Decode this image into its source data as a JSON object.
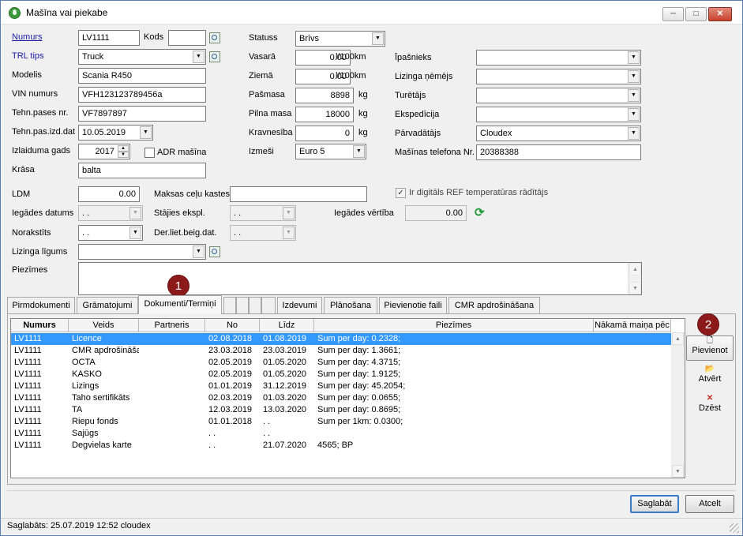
{
  "window": {
    "title": "Mašīna vai piekabe",
    "min": "─",
    "max": "□",
    "close": "✕"
  },
  "labels": {
    "numurs": "Numurs",
    "kods": "Kods",
    "trl_tips": "TRL tips",
    "modelis": "Modelis",
    "vin": "VIN numurs",
    "tehn_pases": "Tehn.pases nr.",
    "tehn_izd": "Tehn.pas.izd.dat",
    "izlaiduma": "Izlaiduma gads",
    "adr": "ADR mašīna",
    "krasa": "Krāsa",
    "statuss": "Statuss",
    "vasara": "Vasarā",
    "ziema": "Ziemā",
    "pasmasa": "Pašmasa",
    "pilna_masa": "Pilna masa",
    "kravnesiba": "Kravnesība",
    "izmesi": "Izmeši",
    "ipasnieks": "Īpašnieks",
    "lizinga_nemejs": "Lizinga ņēmējs",
    "turetajs": "Turētājs",
    "ekspedicija": "Ekspedīcija",
    "parvadatajs": "Pārvadātājs",
    "telefona": "Mašīnas telefona Nr.",
    "unit_l100": "l/100km",
    "unit_kg": "kg",
    "ldm": "LDM",
    "maksas": "Maksas ceļu kastes",
    "ir_digitals": "Ir digitāls REF temperatūras rādītājs",
    "iegades_datums": "Iegādes datums",
    "stajies": "Stājies ekspl.",
    "iegades_vertiba": "Iegādes vērtība",
    "norakstits": "Norakstīts",
    "der_liet": "Der.liet.beig.dat.",
    "lizinga_ligums": "Lizinga līgums",
    "piezimes": "Piezīmes"
  },
  "values": {
    "numurs": "LV1111",
    "kods": "",
    "trl_tips": "Truck",
    "modelis": "Scania R450",
    "vin": "VFH123123789456a",
    "tehn_pases": "VF7897897",
    "tehn_izd": "10.05.2019",
    "izlaiduma": "2017",
    "krasa": "balta",
    "statuss": "Brīvs",
    "vasara": "0.00",
    "ziema": "0.00",
    "pasmasa": "8898",
    "pilna_masa": "18000",
    "kravnesiba": "0",
    "izmesi": "Euro 5",
    "ipasnieks": "",
    "lizinga_nemejs": "",
    "turetajs": "",
    "ekspedicija": "",
    "parvadatajs": "Cloudex",
    "telefona": "20388388",
    "ldm": "0.00",
    "maksas": "",
    "iegades_datums": " .  .",
    "stajies": " .  .",
    "iegades_vertiba": "0.00",
    "norakstits": " .  .",
    "der_liet": " .  .",
    "lizinga_ligums": ""
  },
  "checks": {
    "adr": "",
    "ir_digitals": "✓"
  },
  "tabs": [
    "Pirmdokumenti",
    "Grāmatojumi",
    "Dokumenti/Termiņi",
    "",
    "",
    "",
    "",
    "Izdevumi",
    "Plānošana",
    "Pievienotie faili",
    "CMR apdrošināšana"
  ],
  "grid": {
    "headers": [
      "Numurs",
      "Veids",
      "Partneris",
      "No",
      "Līdz",
      "Piezīmes",
      "Nākamā maiņa pēc"
    ],
    "rows": [
      [
        "LV1111",
        "Licence",
        "",
        "02.08.2018",
        "01.08.2019",
        "Sum per day: 0.2328;",
        ""
      ],
      [
        "LV1111",
        "CMR apdrošināšar",
        "",
        "23.03.2018",
        "23.03.2019",
        "Sum per day: 1.3661;",
        ""
      ],
      [
        "LV1111",
        "OCTA",
        "",
        "02.05.2019",
        "01.05.2020",
        "Sum per day: 4.3715;",
        ""
      ],
      [
        "LV1111",
        "KASKO",
        "",
        "02.05.2019",
        "01.05.2020",
        "Sum per day: 1.9125;",
        ""
      ],
      [
        "LV1111",
        "Lizings",
        "",
        "01.01.2019",
        "31.12.2019",
        "Sum per day: 45.2054;",
        ""
      ],
      [
        "LV1111",
        "Taho sertifikāts",
        "",
        "02.03.2019",
        "01.03.2020",
        "Sum per day: 0.0655;",
        ""
      ],
      [
        "LV1111",
        "TA",
        "",
        "12.03.2019",
        "13.03.2020",
        "Sum per day: 0.8695;",
        ""
      ],
      [
        "LV1111",
        "Riepu fonds",
        "",
        "01.01.2018",
        " .  .",
        "Sum per 1km: 0.0300;",
        ""
      ],
      [
        "LV1111",
        "Sajūgs",
        "",
        " .  .",
        " .  .",
        "",
        ""
      ],
      [
        "LV1111",
        "Degvielas karte",
        "",
        " .  .",
        "21.07.2020",
        "4565; BP",
        ""
      ]
    ]
  },
  "side": {
    "pievienot": "Pievienot",
    "atvert": "Atvērt",
    "dzest": "Dzēst"
  },
  "buttons": {
    "saglabat": "Saglabāt",
    "atcelt": "Atcelt"
  },
  "status": "Saglabāts: 25.07.2019 12:52 cloudex",
  "badges": [
    "1",
    "2"
  ],
  "icons": {
    "dropdown": "▼",
    "scroll_up": "▲",
    "scroll_down": "▼",
    "spin_up": "▲",
    "spin_down": "▼",
    "refresh": "⟳",
    "new_doc": "🗋",
    "open": "📂",
    "delete": "✕"
  }
}
